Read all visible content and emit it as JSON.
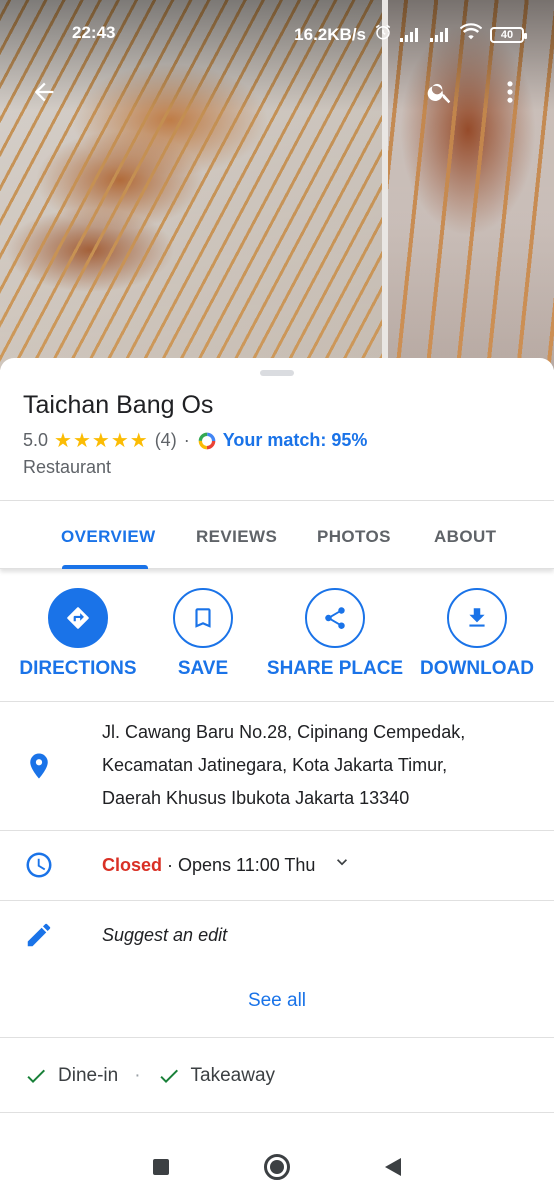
{
  "status_bar": {
    "time": "22:43",
    "net_speed": "16.2KB/s",
    "battery": "40",
    "icons": [
      "alarm-icon",
      "signal-icon",
      "signal-icon",
      "wifi-icon",
      "battery-icon"
    ]
  },
  "header": {
    "back_icon": "arrow-left-icon",
    "search_icon": "search-icon",
    "more_icon": "more-vert-icon"
  },
  "place": {
    "name": "Taichan Bang Os",
    "rating": "5.0",
    "stars": "★★★★★",
    "review_count": "(4)",
    "separator": "·",
    "match": "Your match: 95%",
    "category": "Restaurant"
  },
  "tabs": [
    {
      "label": "OVERVIEW",
      "active": true
    },
    {
      "label": "REVIEWS",
      "active": false
    },
    {
      "label": "PHOTOS",
      "active": false
    },
    {
      "label": "ABOUT",
      "active": false
    }
  ],
  "actions": [
    {
      "label": "DIRECTIONS",
      "icon": "directions-icon"
    },
    {
      "label": "SAVE",
      "icon": "bookmark-icon"
    },
    {
      "label": "SHARE PLACE",
      "icon": "share-icon"
    },
    {
      "label": "DOWNLOAD",
      "icon": "download-icon"
    }
  ],
  "address": {
    "line1": "Jl. Cawang Baru No.28, Cipinang Cempedak,",
    "line2": "Kecamatan Jatinegara, Kota Jakarta Timur,",
    "line3": "Daerah Khusus Ibukota Jakarta 13340",
    "icon": "location-pin-icon"
  },
  "hours": {
    "status": "Closed",
    "detail": " · Opens 11:00 Thu",
    "icon": "clock-icon"
  },
  "suggest_edit": {
    "label": "Suggest an edit",
    "icon": "pencil-icon"
  },
  "see_all": "See all",
  "amenities": [
    {
      "label": "Dine-in",
      "icon": "check-icon"
    },
    {
      "label": "Takeaway",
      "icon": "check-icon"
    }
  ],
  "amenity_separator": "·",
  "colors": {
    "accent": "#1a73e8",
    "closed": "#d93025",
    "stars": "#fbbc04",
    "check": "#188038"
  }
}
